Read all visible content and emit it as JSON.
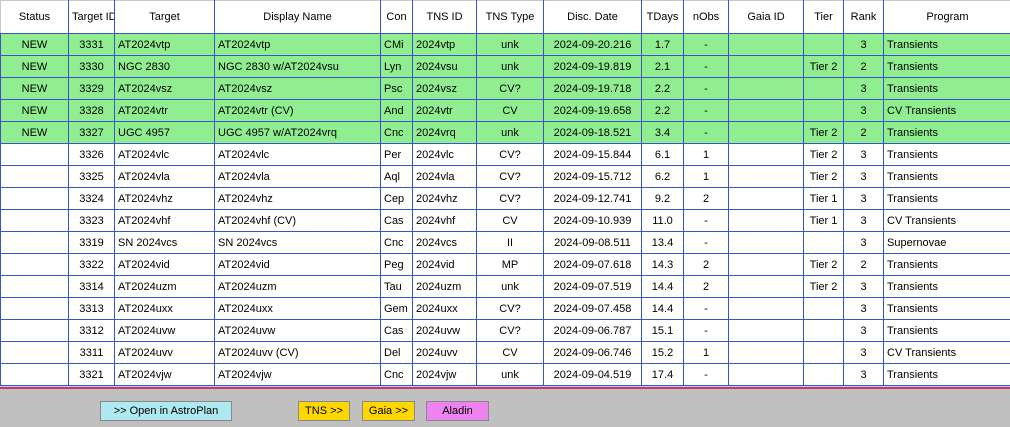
{
  "columns": [
    "Status",
    "Target ID",
    "Target",
    "Display Name",
    "Con",
    "TNS ID",
    "TNS Type",
    "Disc. Date",
    "TDays",
    "nObs",
    "Gaia ID",
    "Tier",
    "Rank",
    "Program"
  ],
  "rows": [
    {
      "status": "NEW",
      "target_id": "3331",
      "target": "AT2024vtp",
      "display_name": "AT2024vtp",
      "con": "CMi",
      "tns_id": "2024vtp",
      "tns_type": "unk",
      "disc_date": "2024-09-20.216",
      "tdays": "1.7",
      "nobs": "-",
      "gaia_id": "",
      "tier": "",
      "rank": "3",
      "program": "Transients"
    },
    {
      "status": "NEW",
      "target_id": "3330",
      "target": "NGC 2830",
      "display_name": "NGC 2830 w/AT2024vsu",
      "con": "Lyn",
      "tns_id": "2024vsu",
      "tns_type": "unk",
      "disc_date": "2024-09-19.819",
      "tdays": "2.1",
      "nobs": "-",
      "gaia_id": "",
      "tier": "Tier 2",
      "rank": "2",
      "program": "Transients"
    },
    {
      "status": "NEW",
      "target_id": "3329",
      "target": "AT2024vsz",
      "display_name": "AT2024vsz",
      "con": "Psc",
      "tns_id": "2024vsz",
      "tns_type": "CV?",
      "disc_date": "2024-09-19.718",
      "tdays": "2.2",
      "nobs": "-",
      "gaia_id": "",
      "tier": "",
      "rank": "3",
      "program": "Transients"
    },
    {
      "status": "NEW",
      "target_id": "3328",
      "target": "AT2024vtr",
      "display_name": "AT2024vtr (CV)",
      "con": "And",
      "tns_id": "2024vtr",
      "tns_type": "CV",
      "disc_date": "2024-09-19.658",
      "tdays": "2.2",
      "nobs": "-",
      "gaia_id": "",
      "tier": "",
      "rank": "3",
      "program": "CV Transients"
    },
    {
      "status": "NEW",
      "target_id": "3327",
      "target": "UGC 4957",
      "display_name": "UGC 4957 w/AT2024vrq",
      "con": "Cnc",
      "tns_id": "2024vrq",
      "tns_type": "unk",
      "disc_date": "2024-09-18.521",
      "tdays": "3.4",
      "nobs": "-",
      "gaia_id": "",
      "tier": "Tier 2",
      "rank": "2",
      "program": "Transients"
    },
    {
      "status": "",
      "target_id": "3326",
      "target": "AT2024vlc",
      "display_name": "AT2024vlc",
      "con": "Per",
      "tns_id": "2024vlc",
      "tns_type": "CV?",
      "disc_date": "2024-09-15.844",
      "tdays": "6.1",
      "nobs": "1",
      "gaia_id": "",
      "tier": "Tier 2",
      "rank": "3",
      "program": "Transients"
    },
    {
      "status": "",
      "target_id": "3325",
      "target": "AT2024vla",
      "display_name": "AT2024vla",
      "con": "Aql",
      "tns_id": "2024vla",
      "tns_type": "CV?",
      "disc_date": "2024-09-15.712",
      "tdays": "6.2",
      "nobs": "1",
      "gaia_id": "",
      "tier": "Tier 2",
      "rank": "3",
      "program": "Transients"
    },
    {
      "status": "",
      "target_id": "3324",
      "target": "AT2024vhz",
      "display_name": "AT2024vhz",
      "con": "Cep",
      "tns_id": "2024vhz",
      "tns_type": "CV?",
      "disc_date": "2024-09-12.741",
      "tdays": "9.2",
      "nobs": "2",
      "gaia_id": "",
      "tier": "Tier 1",
      "rank": "3",
      "program": "Transients"
    },
    {
      "status": "",
      "target_id": "3323",
      "target": "AT2024vhf",
      "display_name": "AT2024vhf (CV)",
      "con": "Cas",
      "tns_id": "2024vhf",
      "tns_type": "CV",
      "disc_date": "2024-09-10.939",
      "tdays": "11.0",
      "nobs": "-",
      "gaia_id": "",
      "tier": "Tier 1",
      "rank": "3",
      "program": "CV Transients"
    },
    {
      "status": "",
      "target_id": "3319",
      "target": "SN 2024vcs",
      "display_name": "SN 2024vcs",
      "con": "Cnc",
      "tns_id": "2024vcs",
      "tns_type": "II",
      "disc_date": "2024-09-08.511",
      "tdays": "13.4",
      "nobs": "-",
      "gaia_id": "",
      "tier": "",
      "rank": "3",
      "program": "Supernovae"
    },
    {
      "status": "",
      "target_id": "3322",
      "target": "AT2024vid",
      "display_name": "AT2024vid",
      "con": "Peg",
      "tns_id": "2024vid",
      "tns_type": "MP",
      "disc_date": "2024-09-07.618",
      "tdays": "14.3",
      "nobs": "2",
      "gaia_id": "",
      "tier": "Tier 2",
      "rank": "2",
      "program": "Transients"
    },
    {
      "status": "",
      "target_id": "3314",
      "target": "AT2024uzm",
      "display_name": "AT2024uzm",
      "con": "Tau",
      "tns_id": "2024uzm",
      "tns_type": "unk",
      "disc_date": "2024-09-07.519",
      "tdays": "14.4",
      "nobs": "2",
      "gaia_id": "",
      "tier": "Tier 2",
      "rank": "3",
      "program": "Transients"
    },
    {
      "status": "",
      "target_id": "3313",
      "target": "AT2024uxx",
      "display_name": "AT2024uxx",
      "con": "Gem",
      "tns_id": "2024uxx",
      "tns_type": "CV?",
      "disc_date": "2024-09-07.458",
      "tdays": "14.4",
      "nobs": "-",
      "gaia_id": "",
      "tier": "",
      "rank": "3",
      "program": "Transients"
    },
    {
      "status": "",
      "target_id": "3312",
      "target": "AT2024uvw",
      "display_name": "AT2024uvw",
      "con": "Cas",
      "tns_id": "2024uvw",
      "tns_type": "CV?",
      "disc_date": "2024-09-06.787",
      "tdays": "15.1",
      "nobs": "-",
      "gaia_id": "",
      "tier": "",
      "rank": "3",
      "program": "Transients"
    },
    {
      "status": "",
      "target_id": "3311",
      "target": "AT2024uvv",
      "display_name": "AT2024uvv (CV)",
      "con": "Del",
      "tns_id": "2024uvv",
      "tns_type": "CV",
      "disc_date": "2024-09-06.746",
      "tdays": "15.2",
      "nobs": "1",
      "gaia_id": "",
      "tier": "",
      "rank": "3",
      "program": "CV Transients"
    },
    {
      "status": "",
      "target_id": "3321",
      "target": "AT2024vjw",
      "display_name": "AT2024vjw",
      "con": "Cnc",
      "tns_id": "2024vjw",
      "tns_type": "unk",
      "disc_date": "2024-09-04.519",
      "tdays": "17.4",
      "nobs": "-",
      "gaia_id": "",
      "tier": "",
      "rank": "3",
      "program": "Transients"
    }
  ],
  "buttons": {
    "astroplan": ">> Open in AstroPlan",
    "tns": "TNS >>",
    "gaia": "Gaia >>",
    "aladin": "Aladin"
  },
  "colors": {
    "new_row": "#90ee90",
    "grid_line": "#3a55c8",
    "footer_bg": "#c0c0c0",
    "astroplan_btn": "#aee8f0",
    "tns_btn": "#ffd700",
    "gaia_btn": "#ffd700",
    "aladin_btn": "#ee82ee"
  }
}
